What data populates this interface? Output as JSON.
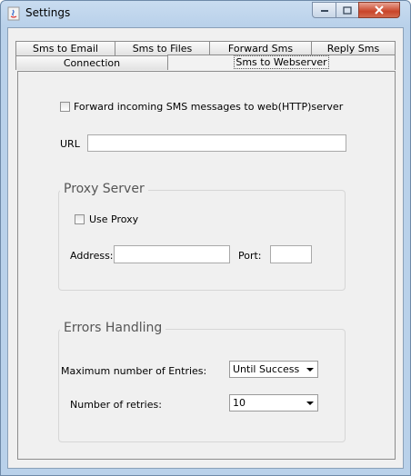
{
  "window": {
    "title": "Settings"
  },
  "tabs": {
    "row_back": [
      "Sms to Email",
      "Sms to Files",
      "Forward Sms",
      "Reply Sms"
    ],
    "row_front": [
      "Connection",
      "Sms to Webserver"
    ],
    "active": "Sms to Webserver"
  },
  "webserver": {
    "forward_label": "Forward incoming SMS messages to web(HTTP)server",
    "forward_checked": false,
    "url_label": "URL",
    "url_value": ""
  },
  "proxy": {
    "title": "Proxy Server",
    "use_proxy_label": "Use Proxy",
    "use_proxy_checked": false,
    "address_label": "Address:",
    "address_value": "",
    "port_label": "Port:",
    "port_value": ""
  },
  "errors": {
    "title": "Errors Handling",
    "max_entries_label": "Maximum number of Entries:",
    "max_entries_value": "Until Success",
    "retries_label": "Number of retries:",
    "retries_value": "10"
  }
}
